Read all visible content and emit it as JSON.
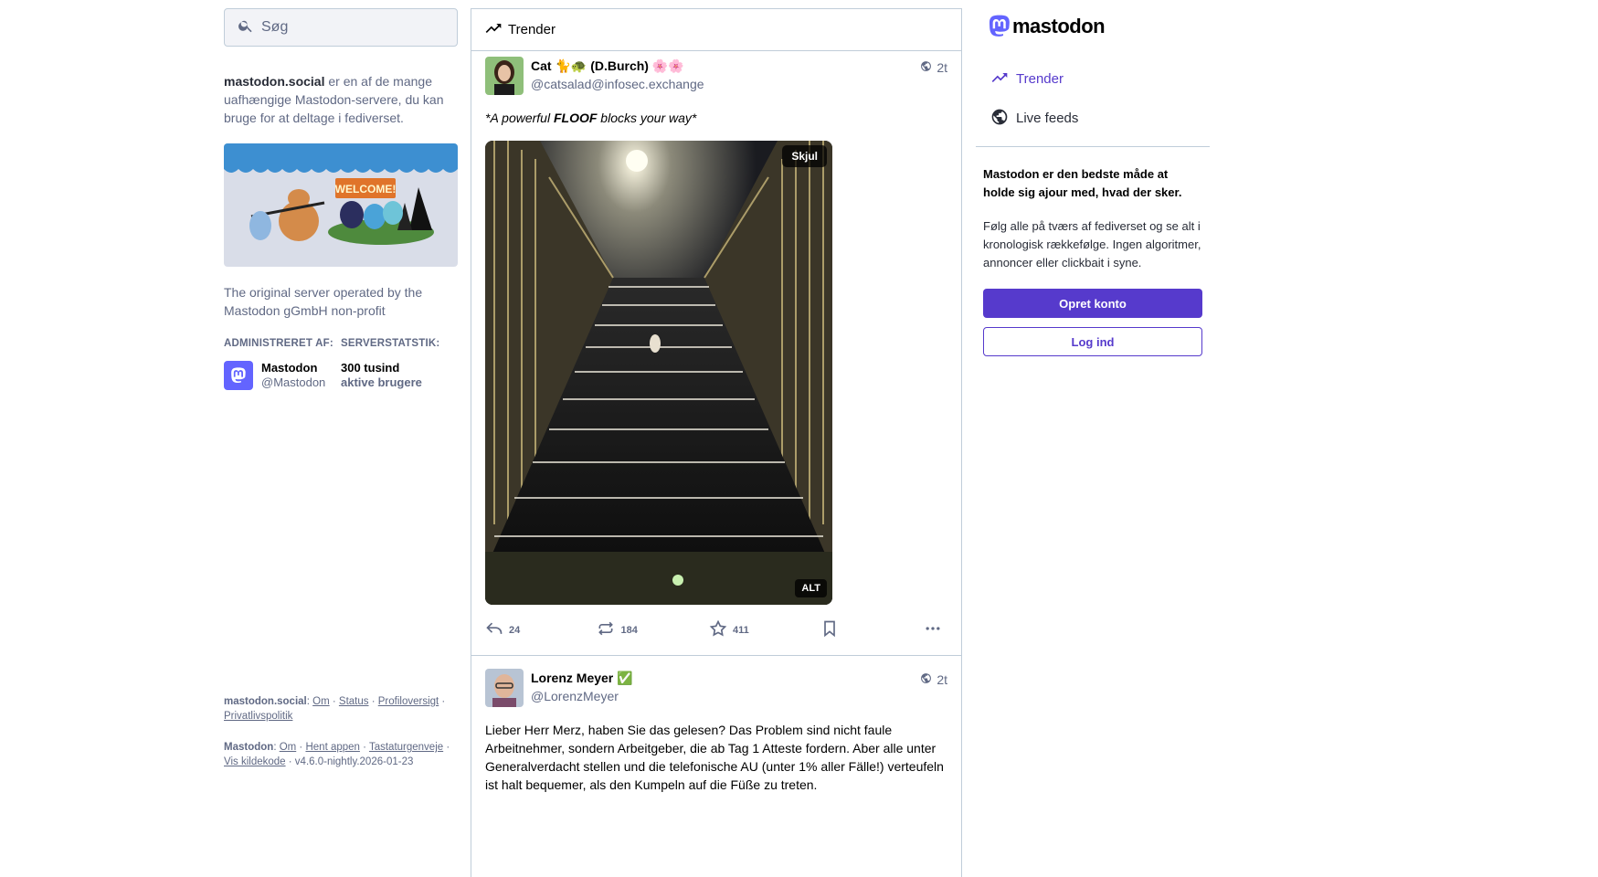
{
  "search": {
    "placeholder": "Søg"
  },
  "about": {
    "server": "mastodon.social",
    "text": " er en af de mange uafhængige Mastodon-servere, du kan bruge for at deltage i fediverset."
  },
  "hero": {
    "banner_text": "WELCOME!"
  },
  "server_description": "The original server operated by the Mastodon gGmbH non-profit",
  "admin": {
    "title": "ADMINISTRERET AF:",
    "name": "Mastodon",
    "handle": "@Mastodon"
  },
  "server_stats": {
    "title": "SERVERSTATSTIK:",
    "value": "300 tusind",
    "label": "aktive brugere"
  },
  "footer": {
    "server_label": "mastodon.social",
    "server_links": [
      "Om",
      "Status",
      "Profiloversigt",
      "Privatlivspolitik"
    ],
    "app_label": "Mastodon",
    "app_links": [
      "Om",
      "Hent appen",
      "Tastaturgenveje",
      "Vis kildekode"
    ],
    "version": "v4.6.0-nightly.2026-01-23"
  },
  "column": {
    "title": "Trender",
    "icon": "trending-icon"
  },
  "statuses": [
    {
      "display_name": "Cat 🐈🐢 (D.Burch) 🌸🌸",
      "acct": "@catsalad@infosec.exchange",
      "time": "2t",
      "text_prefix": "*A powerful ",
      "text_bold": "FLOOF",
      "text_suffix": " blocks your way*",
      "media_hide": "Skjul",
      "media_alt": "ALT",
      "replies": "24",
      "boosts": "184",
      "favourites": "411"
    },
    {
      "display_name": "Lorenz Meyer ✅",
      "acct": "@LorenzMeyer",
      "time": "2t",
      "text": "Lieber Herr Merz, haben Sie das gelesen? Das Problem sind nicht faule Arbeitnehmer, sondern Arbeitgeber, die ab Tag 1 Atteste fordern. Aber alle unter Generalverdacht stellen und die telefonische AU (unter 1% aller Fälle!) verteufeln ist halt bequemer, als den Kumpeln auf die Füße zu treten."
    }
  ],
  "brand": {
    "name": "mastodon",
    "accent": "#563acc",
    "brand_color": "#6364ff"
  },
  "nav": {
    "trends": "Trender",
    "live_feeds": "Live feeds"
  },
  "promo": {
    "title": "Mastodon er den bedste måde at holde sig ajour med, hvad der sker.",
    "body": "Følg alle på tværs af fediverset og se alt i kronologisk rækkefølge. Ingen algoritmer, annoncer eller clickbait i syne.",
    "signup": "Opret konto",
    "login": "Log ind"
  }
}
